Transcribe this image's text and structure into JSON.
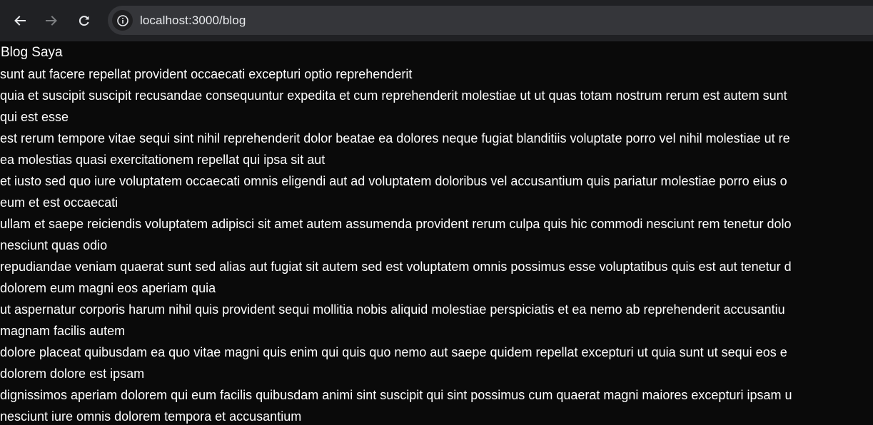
{
  "browser": {
    "url": "localhost:3000/blog",
    "icons": {
      "back": "arrow-left-icon",
      "forward": "arrow-right-icon",
      "reload": "reload-icon",
      "site_info": "info-circle-icon"
    },
    "colors": {
      "toolbar": "#202124",
      "omnibox": "#35363a",
      "page_bg": "#0a0a0a",
      "text": "#ffffff"
    }
  },
  "page": {
    "title": "Blog Saya",
    "posts": [
      {
        "title": "sunt aut facere repellat provident occaecati excepturi optio reprehenderit",
        "body": "quia et suscipit suscipit recusandae consequuntur expedita et cum reprehenderit molestiae ut ut quas totam nostrum rerum est autem sunt"
      },
      {
        "title": "qui est esse",
        "body": "est rerum tempore vitae sequi sint nihil reprehenderit dolor beatae ea dolores neque fugiat blanditiis voluptate porro vel nihil molestiae ut re"
      },
      {
        "title": "ea molestias quasi exercitationem repellat qui ipsa sit aut",
        "body": "et iusto sed quo iure voluptatem occaecati omnis eligendi aut ad voluptatem doloribus vel accusantium quis pariatur molestiae porro eius o"
      },
      {
        "title": "eum et est occaecati",
        "body": "ullam et saepe reiciendis voluptatem adipisci sit amet autem assumenda provident rerum culpa quis hic commodi nesciunt rem tenetur dolo"
      },
      {
        "title": "nesciunt quas odio",
        "body": "repudiandae veniam quaerat sunt sed alias aut fugiat sit autem sed est voluptatem omnis possimus esse voluptatibus quis est aut tenetur d"
      },
      {
        "title": "dolorem eum magni eos aperiam quia",
        "body": "ut aspernatur corporis harum nihil quis provident sequi mollitia nobis aliquid molestiae perspiciatis et ea nemo ab reprehenderit accusantiu"
      },
      {
        "title": "magnam facilis autem",
        "body": "dolore placeat quibusdam ea quo vitae magni quis enim qui quis quo nemo aut saepe quidem repellat excepturi ut quia sunt ut sequi eos e"
      },
      {
        "title": "dolorem dolore est ipsam",
        "body": "dignissimos aperiam dolorem qui eum facilis quibusdam animi sint suscipit qui sint possimus cum quaerat magni maiores excepturi ipsam u"
      },
      {
        "title": "nesciunt iure omnis dolorem tempora et accusantium",
        "body": ""
      }
    ]
  }
}
